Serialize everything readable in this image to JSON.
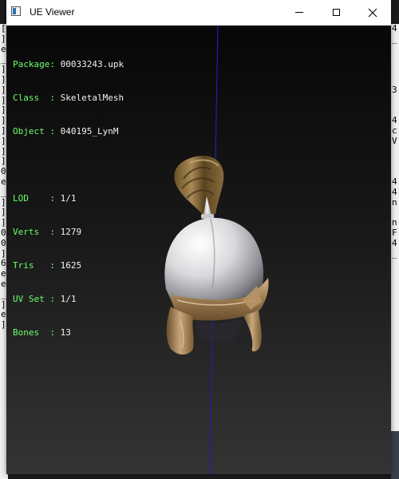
{
  "window": {
    "title": "UE Viewer"
  },
  "info": {
    "package_label": "Package:",
    "package_value": "00033243.upk",
    "class_label": "Class  :",
    "class_value": "SkeletalMesh",
    "object_label": "Object :",
    "object_value": "040195_LynM",
    "lod_label": "LOD    :",
    "lod_value": "1/1",
    "verts_label": "Verts  :",
    "verts_value": "1279",
    "tris_label": "Tris   :",
    "tris_value": "1625",
    "uvset_label": "UV Set :",
    "uvset_value": "1/1",
    "bones_label": "Bones  :",
    "bones_value": "13"
  },
  "background_console": {
    "left_chars": [
      "[",
      "]",
      "e",
      "_",
      "]",
      "]",
      "]",
      "]",
      "]",
      "]",
      "]",
      "]",
      "]",
      "]",
      "0",
      "e",
      "_",
      "]",
      "]",
      "]",
      "0",
      "0",
      "]",
      "6",
      "e",
      "e",
      "_",
      "]",
      "e",
      "]"
    ],
    "right_chars": [
      "4",
      "_",
      "",
      "",
      "",
      "",
      "3",
      "",
      "",
      "4",
      "c",
      "V",
      "",
      "",
      "",
      "4",
      "4",
      "n",
      "",
      "n",
      "F",
      "4",
      "_"
    ]
  },
  "colors": {
    "info_label": "#6cff6c",
    "info_value": "#f2f2f2",
    "axis_line": "#1e1eb4"
  }
}
